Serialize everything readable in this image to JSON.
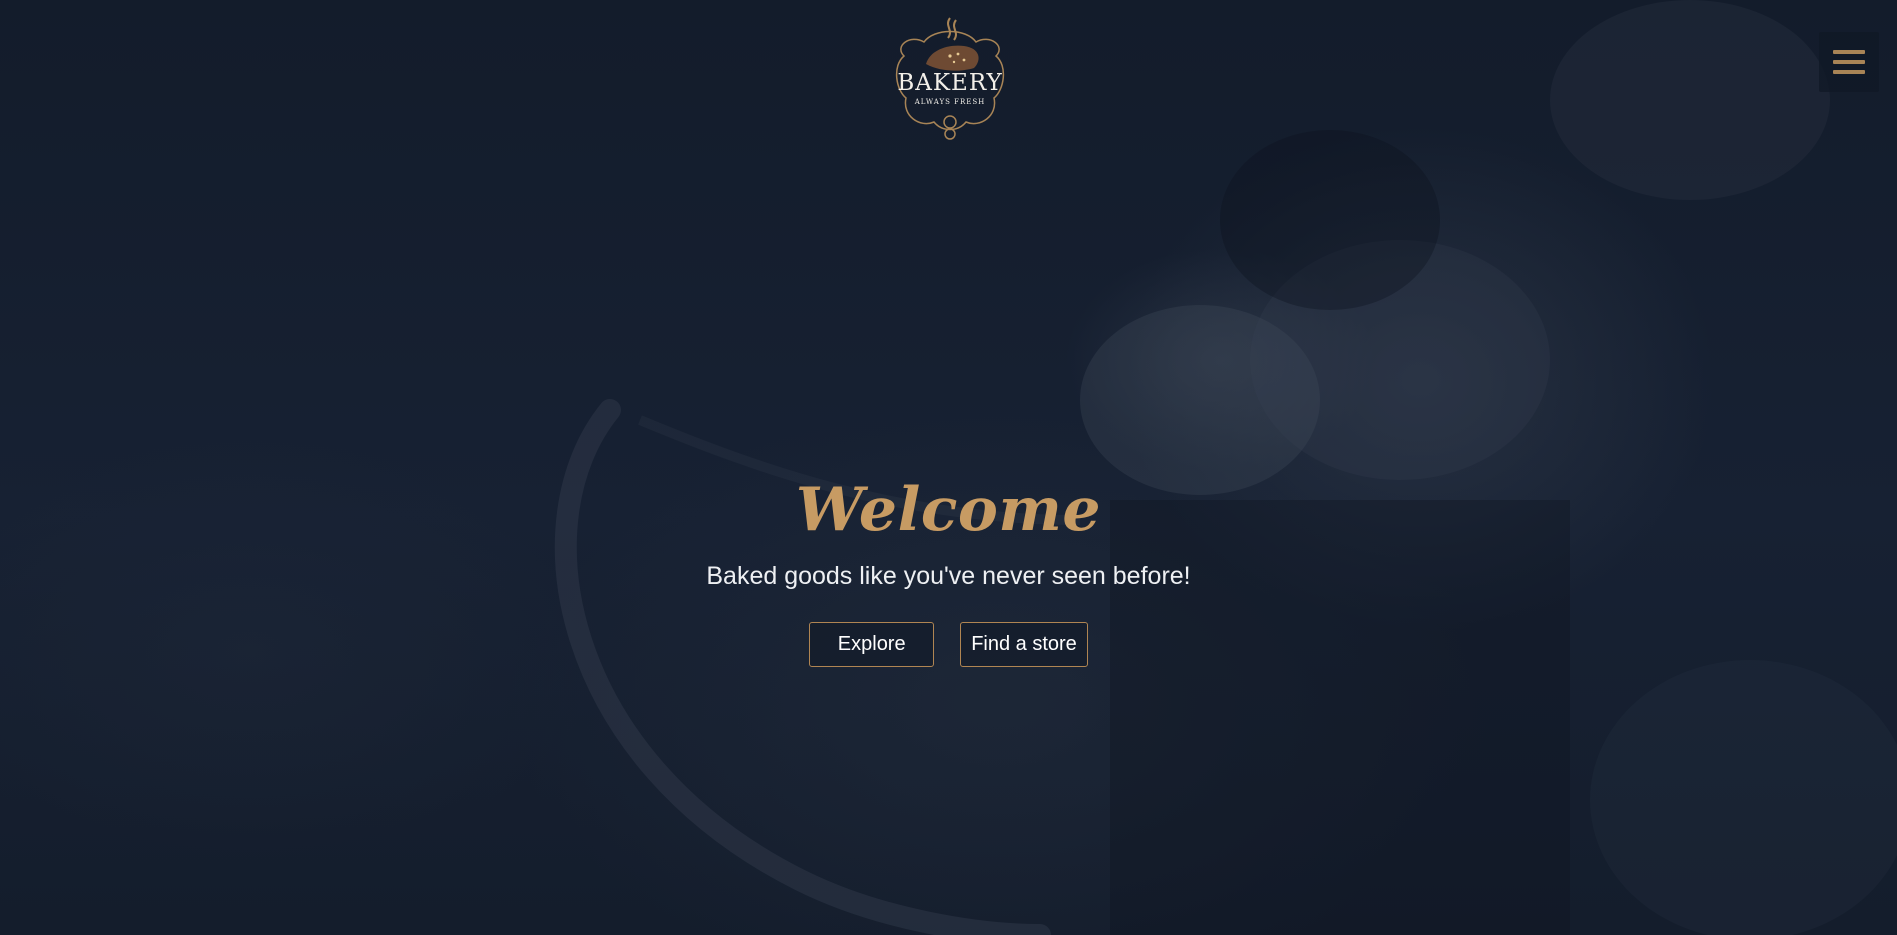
{
  "logo": {
    "name": "BAKERY",
    "tagline": "ALWAYS FRESH",
    "accent_color": "#c79b63"
  },
  "menu": {
    "icon": "hamburger-menu-icon"
  },
  "hero": {
    "heading": "Welcome",
    "subheading": "Baked goods like you've never seen before!",
    "buttons": [
      {
        "label": "Explore"
      },
      {
        "label": "Find a store"
      }
    ]
  },
  "colors": {
    "background": "#141d2c",
    "accent": "#c79b63",
    "text": "#eef0f3"
  }
}
